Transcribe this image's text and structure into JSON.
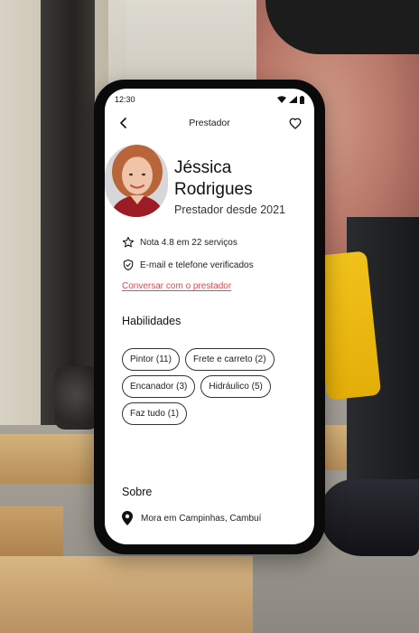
{
  "status_bar": {
    "time": "12:30",
    "icons": [
      "wifi-icon",
      "signal-icon",
      "battery-icon"
    ]
  },
  "header": {
    "back_icon": "chevron-left-icon",
    "title": "Prestador",
    "favorite_icon": "heart-outline-icon"
  },
  "profile": {
    "name": "Jéssica Rodrigues",
    "since": "Prestador desde 2021"
  },
  "info": [
    {
      "icon": "star-outline-icon",
      "text": "Nota 4.8 em 22 serviços"
    },
    {
      "icon": "shield-check-icon",
      "text": "E-mail e telefone verificados"
    }
  ],
  "contact_link": "Conversar com o prestador",
  "skills": {
    "title": "Habilidades",
    "items": [
      "Pintor (11)",
      "Frete e carreto (2)",
      "Encanador (3)",
      "Hidráulico (5)",
      "Faz tudo (1)"
    ]
  },
  "about": {
    "title": "Sobre",
    "location_icon": "map-pin-icon",
    "location": "Mora em Campinhas, Cambuí"
  },
  "colors": {
    "accent": "#e5484d",
    "text": "#111111",
    "phone_frame": "#0a0a0a"
  }
}
